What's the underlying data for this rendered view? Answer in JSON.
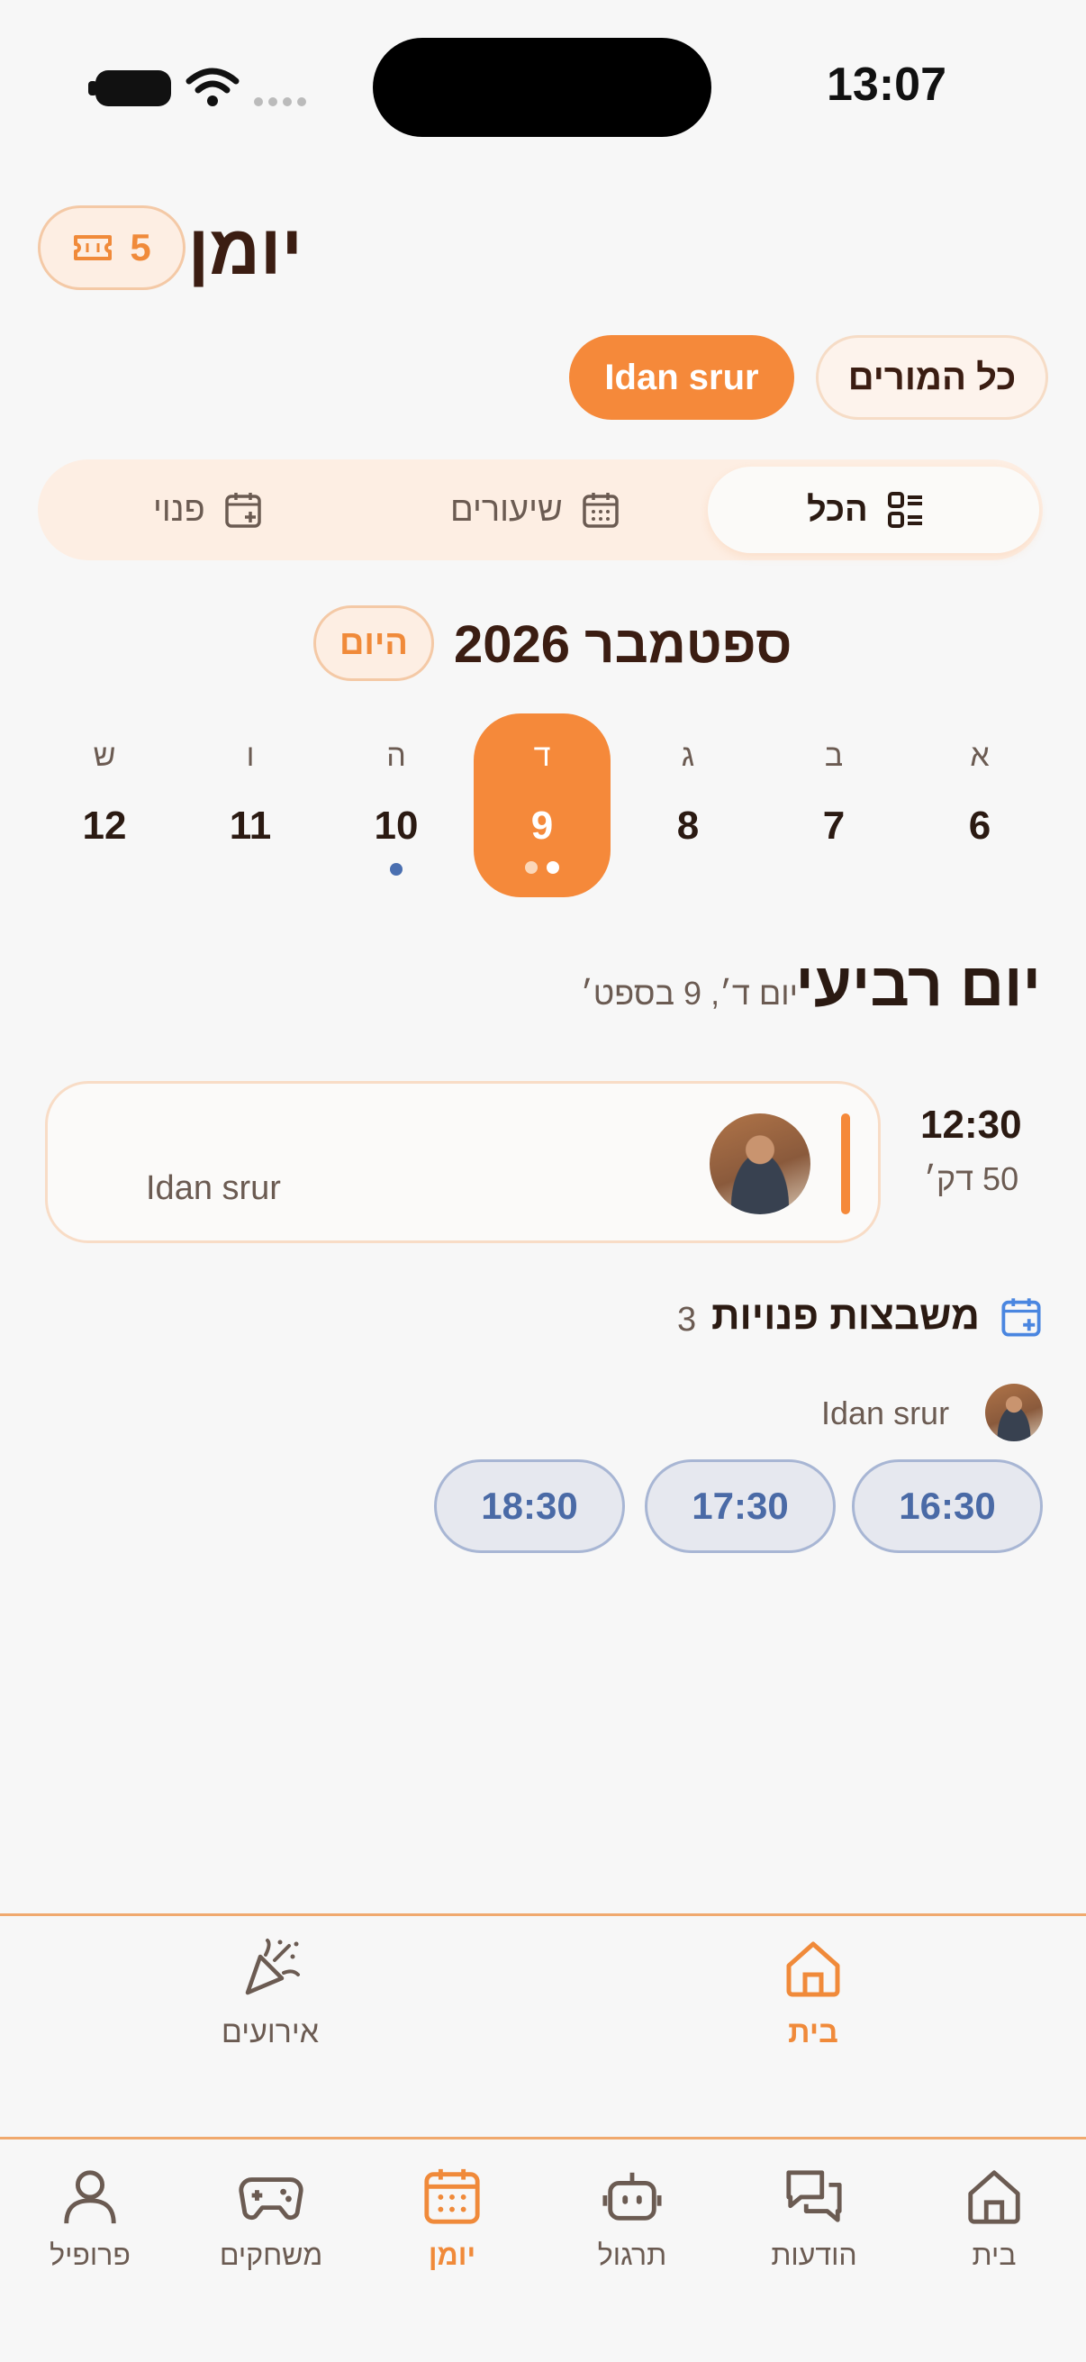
{
  "status_bar": {
    "time": "13:07"
  },
  "header": {
    "title": "יומן",
    "credits": "5"
  },
  "teacher_filters": {
    "all_label": "כל המורים",
    "selected_label": "Idan srur"
  },
  "view_tabs": {
    "all": "הכל",
    "lessons": "שיעורים",
    "free": "פנוי"
  },
  "month": {
    "label": "ספטמבר 2026",
    "today_label": "היום"
  },
  "week": [
    {
      "letter": "א",
      "num": "6"
    },
    {
      "letter": "ב",
      "num": "7"
    },
    {
      "letter": "ג",
      "num": "8"
    },
    {
      "letter": "ד",
      "num": "9"
    },
    {
      "letter": "ה",
      "num": "10"
    },
    {
      "letter": "ו",
      "num": "11"
    },
    {
      "letter": "ש",
      "num": "12"
    }
  ],
  "day": {
    "heading": "יום רביעי",
    "subtitle": "יום ד׳, 9 בספט׳"
  },
  "lesson": {
    "time": "12:30",
    "duration": "50 דק׳",
    "teacher": "Idan srur"
  },
  "free_slots": {
    "title": "משבצות פנויות",
    "count": "3",
    "teacher": "Idan srur",
    "times": [
      "16:30",
      "17:30",
      "18:30"
    ]
  },
  "secondary_nav": {
    "home": "בית",
    "events": "אירועים"
  },
  "bottom_nav": {
    "home": "בית",
    "messages": "הודעות",
    "practice": "תרגול",
    "diary": "יומן",
    "games": "משחקים",
    "profile": "פרופיל"
  },
  "colors": {
    "accent": "#f5893a",
    "slot_blue": "#4a6aa6",
    "text": "#3b1d12"
  }
}
